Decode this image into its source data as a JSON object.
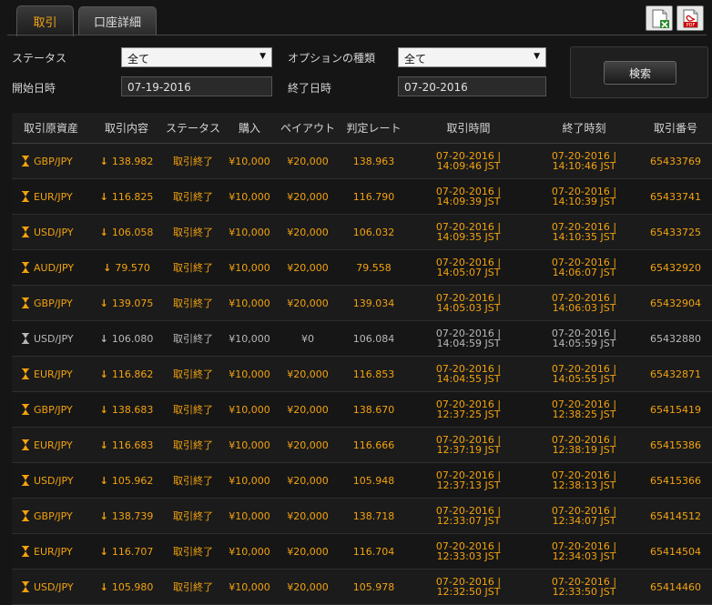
{
  "tabs": [
    {
      "label": "取引",
      "active": true
    },
    {
      "label": "口座詳細",
      "active": false
    }
  ],
  "toolbar": {
    "excel_icon": "excel-export-icon",
    "pdf_icon": "pdf-export-icon",
    "pdf_text": "PDF"
  },
  "filters": {
    "status_label": "ステータス",
    "status_value": "全て",
    "option_type_label": "オプションの種類",
    "option_type_value": "全て",
    "start_label": "開始日時",
    "start_value": "07-19-2016",
    "end_label": "終了日時",
    "end_value": "07-20-2016",
    "search_label": "検索"
  },
  "table": {
    "headers": [
      "取引原資産",
      "取引内容",
      "ステータス",
      "購入",
      "ペイアウト",
      "判定レート",
      "取引時間",
      "終了時刻",
      "取引番号"
    ],
    "rows": [
      {
        "asset": "GBP/JPY",
        "content": "138.982",
        "status": "取引終了",
        "purchase": "¥10,000",
        "payout": "¥20,000",
        "rate": "138.963",
        "trade_time_1": "07-20-2016 |",
        "trade_time_2": "14:09:46 JST",
        "end_time_1": "07-20-2016 |",
        "end_time_2": "14:10:46 JST",
        "id": "65433769",
        "gray": false
      },
      {
        "asset": "EUR/JPY",
        "content": "116.825",
        "status": "取引終了",
        "purchase": "¥10,000",
        "payout": "¥20,000",
        "rate": "116.790",
        "trade_time_1": "07-20-2016 |",
        "trade_time_2": "14:09:39 JST",
        "end_time_1": "07-20-2016 |",
        "end_time_2": "14:10:39 JST",
        "id": "65433741",
        "gray": false
      },
      {
        "asset": "USD/JPY",
        "content": "106.058",
        "status": "取引終了",
        "purchase": "¥10,000",
        "payout": "¥20,000",
        "rate": "106.032",
        "trade_time_1": "07-20-2016 |",
        "trade_time_2": "14:09:35 JST",
        "end_time_1": "07-20-2016 |",
        "end_time_2": "14:10:35 JST",
        "id": "65433725",
        "gray": false
      },
      {
        "asset": "AUD/JPY",
        "content": "79.570",
        "status": "取引終了",
        "purchase": "¥10,000",
        "payout": "¥20,000",
        "rate": "79.558",
        "trade_time_1": "07-20-2016 |",
        "trade_time_2": "14:05:07 JST",
        "end_time_1": "07-20-2016 |",
        "end_time_2": "14:06:07 JST",
        "id": "65432920",
        "gray": false
      },
      {
        "asset": "GBP/JPY",
        "content": "139.075",
        "status": "取引終了",
        "purchase": "¥10,000",
        "payout": "¥20,000",
        "rate": "139.034",
        "trade_time_1": "07-20-2016 |",
        "trade_time_2": "14:05:03 JST",
        "end_time_1": "07-20-2016 |",
        "end_time_2": "14:06:03 JST",
        "id": "65432904",
        "gray": false
      },
      {
        "asset": "USD/JPY",
        "content": "106.080",
        "status": "取引終了",
        "purchase": "¥10,000",
        "payout": "¥0",
        "rate": "106.084",
        "trade_time_1": "07-20-2016 |",
        "trade_time_2": "14:04:59 JST",
        "end_time_1": "07-20-2016 |",
        "end_time_2": "14:05:59 JST",
        "id": "65432880",
        "gray": true
      },
      {
        "asset": "EUR/JPY",
        "content": "116.862",
        "status": "取引終了",
        "purchase": "¥10,000",
        "payout": "¥20,000",
        "rate": "116.853",
        "trade_time_1": "07-20-2016 |",
        "trade_time_2": "14:04:55 JST",
        "end_time_1": "07-20-2016 |",
        "end_time_2": "14:05:55 JST",
        "id": "65432871",
        "gray": false
      },
      {
        "asset": "GBP/JPY",
        "content": "138.683",
        "status": "取引終了",
        "purchase": "¥10,000",
        "payout": "¥20,000",
        "rate": "138.670",
        "trade_time_1": "07-20-2016 |",
        "trade_time_2": "12:37:25 JST",
        "end_time_1": "07-20-2016 |",
        "end_time_2": "12:38:25 JST",
        "id": "65415419",
        "gray": false
      },
      {
        "asset": "EUR/JPY",
        "content": "116.683",
        "status": "取引終了",
        "purchase": "¥10,000",
        "payout": "¥20,000",
        "rate": "116.666",
        "trade_time_1": "07-20-2016 |",
        "trade_time_2": "12:37:19 JST",
        "end_time_1": "07-20-2016 |",
        "end_time_2": "12:38:19 JST",
        "id": "65415386",
        "gray": false
      },
      {
        "asset": "USD/JPY",
        "content": "105.962",
        "status": "取引終了",
        "purchase": "¥10,000",
        "payout": "¥20,000",
        "rate": "105.948",
        "trade_time_1": "07-20-2016 |",
        "trade_time_2": "12:37:13 JST",
        "end_time_1": "07-20-2016 |",
        "end_time_2": "12:38:13 JST",
        "id": "65415366",
        "gray": false
      },
      {
        "asset": "GBP/JPY",
        "content": "138.739",
        "status": "取引終了",
        "purchase": "¥10,000",
        "payout": "¥20,000",
        "rate": "138.718",
        "trade_time_1": "07-20-2016 |",
        "trade_time_2": "12:33:07 JST",
        "end_time_1": "07-20-2016 |",
        "end_time_2": "12:34:07 JST",
        "id": "65414512",
        "gray": false
      },
      {
        "asset": "EUR/JPY",
        "content": "116.707",
        "status": "取引終了",
        "purchase": "¥10,000",
        "payout": "¥20,000",
        "rate": "116.704",
        "trade_time_1": "07-20-2016 |",
        "trade_time_2": "12:33:03 JST",
        "end_time_1": "07-20-2016 |",
        "end_time_2": "12:34:03 JST",
        "id": "65414504",
        "gray": false
      },
      {
        "asset": "USD/JPY",
        "content": "105.980",
        "status": "取引終了",
        "purchase": "¥10,000",
        "payout": "¥20,000",
        "rate": "105.978",
        "trade_time_1": "07-20-2016 |",
        "trade_time_2": "12:32:50 JST",
        "end_time_1": "07-20-2016 |",
        "end_time_2": "12:33:50 JST",
        "id": "65414460",
        "gray": false
      }
    ]
  },
  "colors": {
    "accent": "#f2a20f",
    "background": "#151515",
    "muted": "#b8b8b8"
  }
}
